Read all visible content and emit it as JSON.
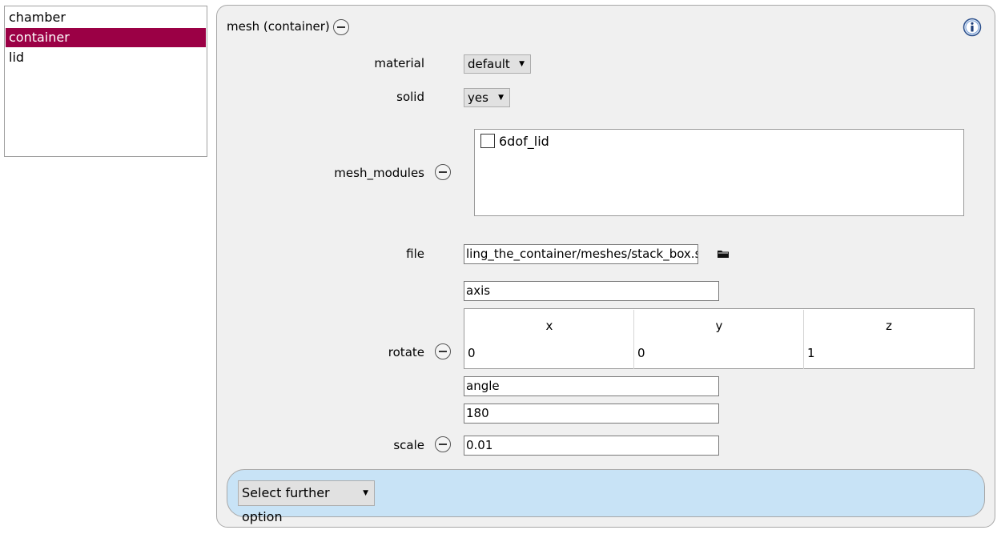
{
  "mesh_list": {
    "items": [
      {
        "label": "chamber",
        "selected": false
      },
      {
        "label": "container",
        "selected": true
      },
      {
        "label": "lid",
        "selected": false
      }
    ]
  },
  "panel": {
    "title": "mesh (container)",
    "info_icon": "info-icon",
    "material": {
      "label": "material",
      "value": "default"
    },
    "solid": {
      "label": "solid",
      "value": "yes"
    },
    "mesh_modules": {
      "label": "mesh_modules",
      "items": [
        {
          "label": "6dof_lid",
          "checked": false
        }
      ]
    },
    "file": {
      "label": "file",
      "value": "ling_the_container/meshes/stack_box.stl",
      "icon": "folder-icon"
    },
    "rotate": {
      "label": "rotate",
      "axis_field": "axis",
      "columns": [
        "x",
        "y",
        "z"
      ],
      "values": [
        "0",
        "0",
        "1"
      ],
      "angle_field": "angle",
      "angle_value": "180"
    },
    "scale": {
      "label": "scale",
      "value": "0.01"
    },
    "further": {
      "label": "Select further option"
    }
  },
  "colors": {
    "selection": "#9b0045",
    "further_bar": "#c8e3f6",
    "panel_bg": "#f0f0f0"
  }
}
